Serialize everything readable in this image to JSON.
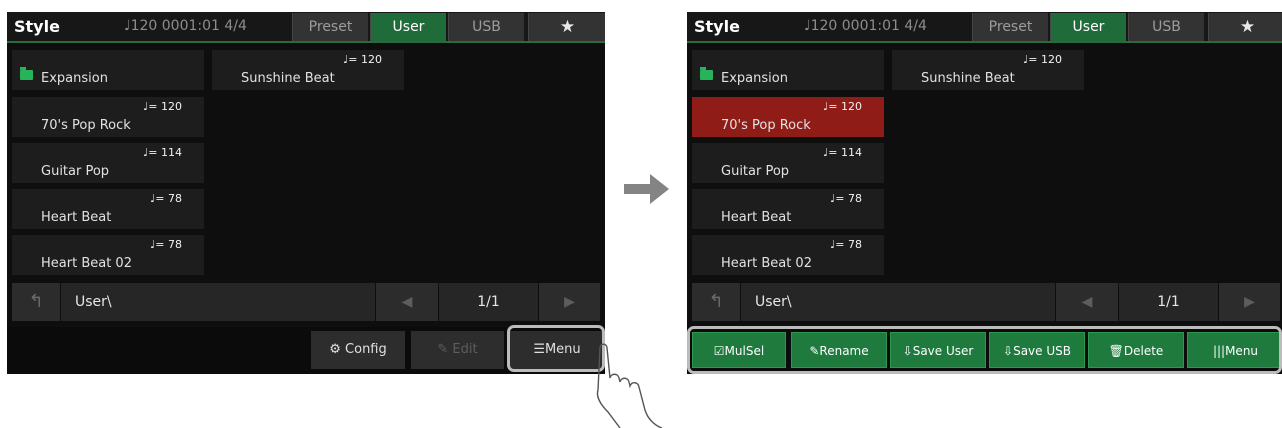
{
  "header": {
    "title": "Style",
    "tempo": "♩120  0001:01  4/4",
    "tabs": [
      "Preset",
      "User",
      "USB"
    ],
    "star": "★"
  },
  "styles": [
    {
      "name": "Expansion",
      "type": "folder"
    },
    {
      "name": "70's Pop Rock",
      "tempo": "♩= 120"
    },
    {
      "name": "Guitar Pop",
      "tempo": "♩= 114"
    },
    {
      "name": "Heart Beat",
      "tempo": "♩= 78"
    },
    {
      "name": "Heart Beat 02",
      "tempo": "♩= 78"
    },
    {
      "name": "Sunshine Beat",
      "tempo": "♩= 120"
    }
  ],
  "nav": {
    "back": "↰",
    "path": "User\\",
    "prev": "◀",
    "page": "1/1",
    "next": "▶"
  },
  "left_buttons": {
    "config": "⚙ Config",
    "edit": "✎ Edit",
    "menu": "☰Menu"
  },
  "right_buttons": {
    "mulsel": "☑MulSel",
    "rename": "✎Rename",
    "save_user": "⇩Save User",
    "save_usb": "⇩Save USB",
    "delete": "🗑Delete",
    "menu": "|||Menu"
  },
  "colors": {
    "accent_green": "#1e7b3d",
    "selected_red": "#8f1c16",
    "background": "#0e0e0e"
  }
}
